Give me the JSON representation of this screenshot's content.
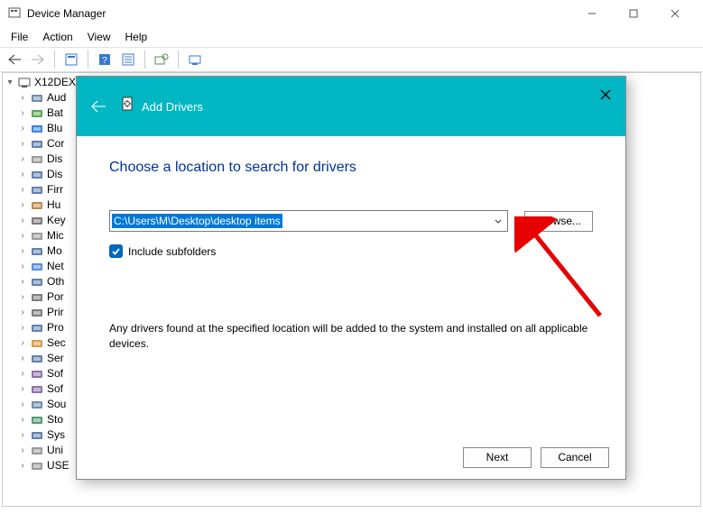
{
  "window": {
    "title": "Device Manager"
  },
  "menu": {
    "file": "File",
    "action": "Action",
    "view": "View",
    "help": "Help"
  },
  "tree": {
    "root": "X12DEX",
    "items": [
      {
        "label": "Aud",
        "color": "#5a7aa0"
      },
      {
        "label": "Bat",
        "color": "#3a9a3a"
      },
      {
        "label": "Blu",
        "color": "#1a6ae0"
      },
      {
        "label": "Cor",
        "color": "#4a6aa0"
      },
      {
        "label": "Dis",
        "color": "#888"
      },
      {
        "label": "Dis",
        "color": "#4a6aa0"
      },
      {
        "label": "Firr",
        "color": "#4a6aa0"
      },
      {
        "label": "Hu",
        "color": "#b0783a"
      },
      {
        "label": "Key",
        "color": "#666"
      },
      {
        "label": "Mic",
        "color": "#888"
      },
      {
        "label": "Mo",
        "color": "#4a6aa0"
      },
      {
        "label": "Net",
        "color": "#3a7ad0"
      },
      {
        "label": "Oth",
        "color": "#4a6aa0"
      },
      {
        "label": "Por",
        "color": "#666"
      },
      {
        "label": "Prir",
        "color": "#666"
      },
      {
        "label": "Pro",
        "color": "#4a6aa0"
      },
      {
        "label": "Sec",
        "color": "#d08a2a"
      },
      {
        "label": "Ser",
        "color": "#4a6aa0"
      },
      {
        "label": "Sof",
        "color": "#7a5aa0"
      },
      {
        "label": "Sof",
        "color": "#7a5aa0"
      },
      {
        "label": "Sou",
        "color": "#5a7aa0"
      },
      {
        "label": "Sto",
        "color": "#3a8a5a"
      },
      {
        "label": "Sys",
        "color": "#4a6aa0"
      },
      {
        "label": "Uni",
        "color": "#888"
      },
      {
        "label": "USE",
        "color": "#888"
      }
    ]
  },
  "dialog": {
    "title": "Add Drivers",
    "heading": "Choose a location to search for drivers",
    "path": "C:\\Users\\M\\Desktop\\desktop items",
    "browse": "Browse...",
    "include": "Include subfolders",
    "note": "Any drivers found at the specified location will be added to the system and installed on all applicable devices.",
    "next": "Next",
    "cancel": "Cancel"
  }
}
